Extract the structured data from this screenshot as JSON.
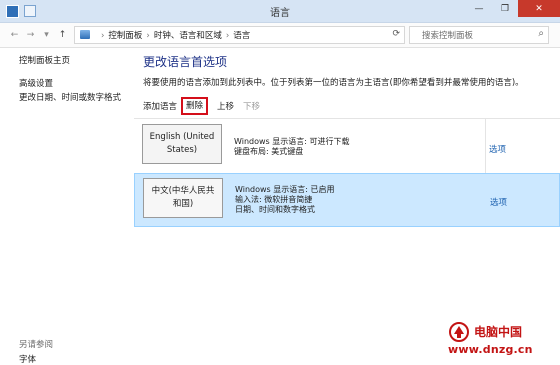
{
  "window": {
    "title": "语言",
    "buttons": [
      "—",
      "❐",
      "✕"
    ]
  },
  "nav": {
    "breadcrumbs": [
      "控制面板",
      "时钟、语言和区域",
      "语言"
    ],
    "search_placeholder": "搜索控制面板"
  },
  "sidebar": {
    "links": [
      "控制面板主页",
      "高级设置",
      "更改日期、时间或数字格式"
    ],
    "see_also_heading": "另请参阅",
    "see_also_items": [
      "字体"
    ]
  },
  "main": {
    "title": "更改语言首选项",
    "description": "将要使用的语言添加到此列表中。位于列表第一位的语言为主语言(即你希望看到并最常使用的语言)。",
    "toolbar": {
      "add": "添加语言",
      "remove": "删除",
      "up": "上移",
      "down": "下移"
    },
    "languages": [
      {
        "name_line1": "English (United",
        "name_line2": "States)",
        "details": [
          "Windows 显示语言: 可进行下载",
          "键盘布局: 美式键盘"
        ],
        "options": "选项",
        "selected": false
      },
      {
        "name_line1": "中文(中华人民共",
        "name_line2": "和国)",
        "details": [
          "Windows 显示语言: 已启用",
          "输入法: 微软拼音简捷",
          "日期、时间和数字格式"
        ],
        "options": "选项",
        "selected": true
      }
    ]
  },
  "watermark": {
    "name": "电脑中国",
    "url": "www.dnzg.cn"
  },
  "colors": {
    "title_blue": "#1e3287",
    "link_blue": "#1e62b0",
    "selected_row": "#cce8ff",
    "highlight_red": "#d40f1a",
    "watermark_red": "#c31414"
  }
}
